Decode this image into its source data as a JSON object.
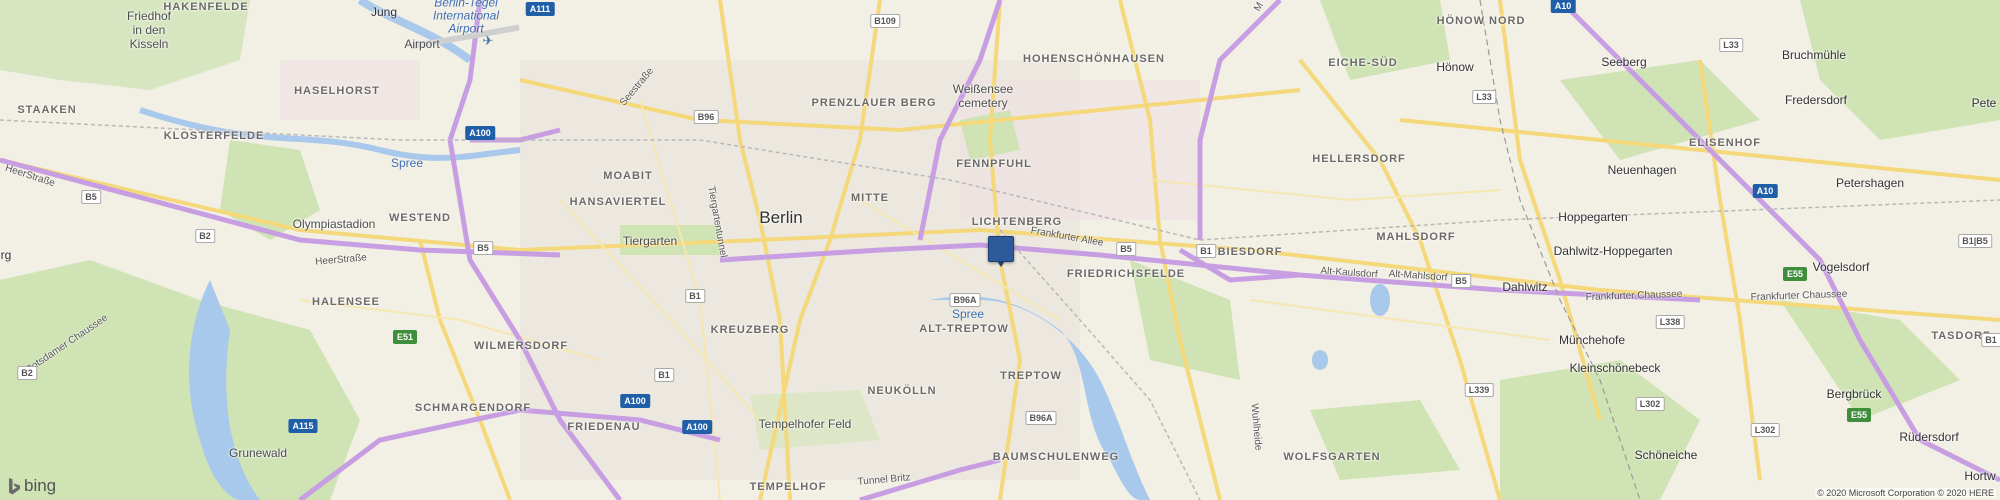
{
  "map": {
    "city": "Berlin",
    "districts": {
      "hakenfelde": "HAKENFELDE",
      "haselhorst": "HASELHORST",
      "staaken": "STAAKEN",
      "klosterfelde": "KLOSTERFELDE",
      "moabit": "MOABIT",
      "hansaviertel": "HANSAVIERTEL",
      "westend": "WESTEND",
      "halensee": "HALENSEE",
      "wilmersdorf": "WILMERSDORF",
      "schmargendorf": "SCHMARGENDORF",
      "friedenau": "FRIEDENAU",
      "tempelhof": "TEMPELHOF",
      "kreuzberg": "KREUZBERG",
      "mitte": "MITTE",
      "prenzlauer_berg": "PRENZLAUER BERG",
      "hohenschoenhausen": "HOHENSCHÖNHAUSEN",
      "fennpfuhl": "FENNPFUHL",
      "lichtenberg": "LICHTENBERG",
      "friedrichsfelde": "FRIEDRICHSFELDE",
      "biesdorf": "BIESDORF",
      "mahlsdorf": "MAHLSDORF",
      "hellersdorf": "HELLERSDORF",
      "eiche_sued": "EICHE-SÜD",
      "hoenow_nord": "HÖNOW NORD",
      "elisenhof": "ELISENHOF",
      "alt_treptow": "ALT-TREPTOW",
      "treptow": "TREPTOW",
      "neukoelln": "NEUKÖLLN",
      "baumschulenweg": "BAUMSCHULENWEG",
      "wolfsgarten": "WOLFSGARTEN",
      "tasdorf": "TASDORF"
    },
    "places": {
      "friedhof": "Friedhof\nin den\nKisseln",
      "olympiastadion": "Olympiastadion",
      "tiergarten": "Tiergarten",
      "tempelhofer_feld": "Tempelhofer Feld",
      "grunewald": "Grunewald",
      "weissensee": "Weißensee\ncemetery",
      "hoenow": "Hönow",
      "seeberg": "Seeberg",
      "bruchmuehle": "Bruchmühle",
      "fredersdorf": "Fredersdorf",
      "neuenhagen": "Neuenhagen",
      "petershagen": "Petershagen",
      "hoppegarten": "Hoppegarten",
      "dahlwitz_hoppegarten": "Dahlwitz-Hoppegarten",
      "dahlwitz": "Dahlwitz",
      "vogelsdorf": "Vogelsdorf",
      "muenchehofe": "Münchehofe",
      "kleinschoenebeck": "Kleinschönebeck",
      "bergbrueck": "Bergbrück",
      "schoeneiche": "Schöneiche",
      "ruedersdorf": "Rüdersdorf",
      "hortw": "Hortw",
      "pete": "Pete",
      "berg": "rg",
      "jung": "Jung"
    },
    "airport": "Berlin-Tegel\nInternational\nAirport",
    "airport_short": "Airport",
    "water": {
      "spree_west": "Spree",
      "spree_east": "Spree"
    },
    "streets": {
      "seestrasse": "Seestraße",
      "heerstrasse_w": "HeerStraße",
      "heerstrasse_c": "HeerStraße",
      "tiergartentunnel": "Tiergartentunnel",
      "frankfurter_allee": "Frankfurter Allee",
      "alt_kaulsdorf": "Alt-Kaulsdorf",
      "alt_mahlsdorf": "Alt-Mahlsdorf",
      "frankfurter_chaussee_1": "Frankfurter Chaussee",
      "frankfurter_chaussee_2": "Frankfurter Chaussee",
      "potsdamer_chaussee": "Potsdamer Chaussee",
      "wuhlheide": "Wuhlheide",
      "tunnel_britz": "Tunnel Britz",
      "m_road": "M"
    },
    "shields": {
      "a111": "A111",
      "b109": "B109",
      "b96": "B96",
      "a100_n": "A100",
      "b5_w": "B5",
      "b2": "B2",
      "b5_c": "B5",
      "b1_c": "B1",
      "e51": "E51",
      "b2_sw": "B2",
      "a115": "A115",
      "b1_s": "B1",
      "a100_s": "A100",
      "a100_s2": "A100",
      "b96a_n": "B96A",
      "b96a_s": "B96A",
      "b5_e": "B5",
      "b1_e": "B1",
      "b5_far": "B5",
      "a10_n": "A10",
      "l33_n": "L33",
      "l33": "L33",
      "a10_c": "A10",
      "b1_b5": "B1|B5",
      "e55": "E55",
      "l338": "L338",
      "l339": "L339",
      "l302": "L302",
      "l302_b": "L302",
      "e55_s": "E55",
      "b1_far": "B1",
      "b1_ff": "B1"
    },
    "logo": "bing",
    "copyright": "© 2020 Microsoft Corporation © 2020 HERE"
  },
  "colors": {
    "land": "#f2efe4",
    "park": "#cfe3b4",
    "water": "#a8c8ec",
    "motorway": "#c89ee3",
    "arterial": "#f4d87a",
    "pin": "#2d5a9a"
  }
}
